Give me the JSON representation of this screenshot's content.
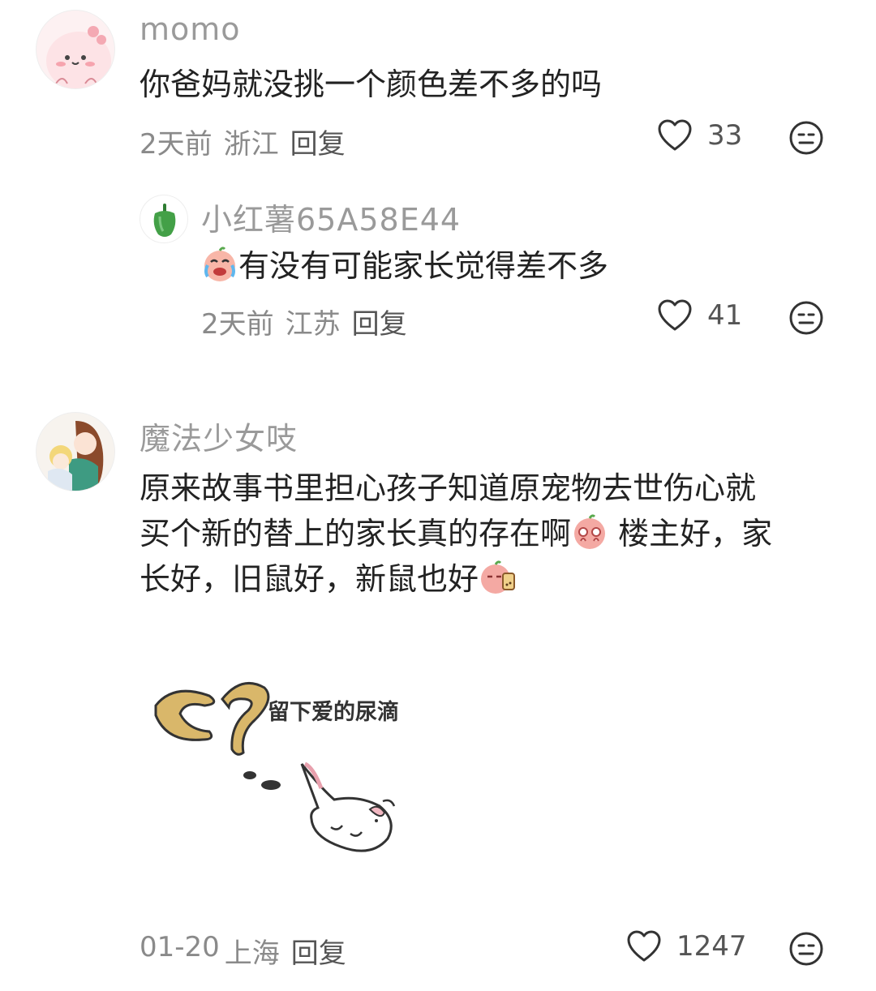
{
  "comments": [
    {
      "username": "momo",
      "text": "你爸妈就没挑一个颜色差不多的吗",
      "time": "2天前",
      "location": "浙江",
      "reply_label": "回复",
      "likes": "33",
      "avatar_icon": "pink-blob-avatar"
    },
    {
      "username": "魔法少女吱",
      "text_lines": [
        "原来故事书里担心孩子知道原宠物去世伤心就",
        "买个新的替上的家长真的存在啊",
        " 楼主好，家",
        "长好，旧鼠好，新鼠也好"
      ],
      "time": "01-20",
      "location": "上海",
      "reply_label": "回复",
      "likes": "1247",
      "sticker_text": "留下爱的尿滴",
      "avatar_icon": "anime-girl-avatar"
    }
  ],
  "reply": {
    "username": "小红薯65A58E44",
    "text": "有没有可能家长觉得差不多",
    "time": "2天前",
    "location": "江苏",
    "reply_label": "回复",
    "likes": "41",
    "avatar_icon": "green-pepper-avatar"
  },
  "colors": {
    "username": "#9a9a9a",
    "text": "#222222",
    "meta": "#8a8a8a",
    "sticker_tan": "#d9b76a"
  }
}
